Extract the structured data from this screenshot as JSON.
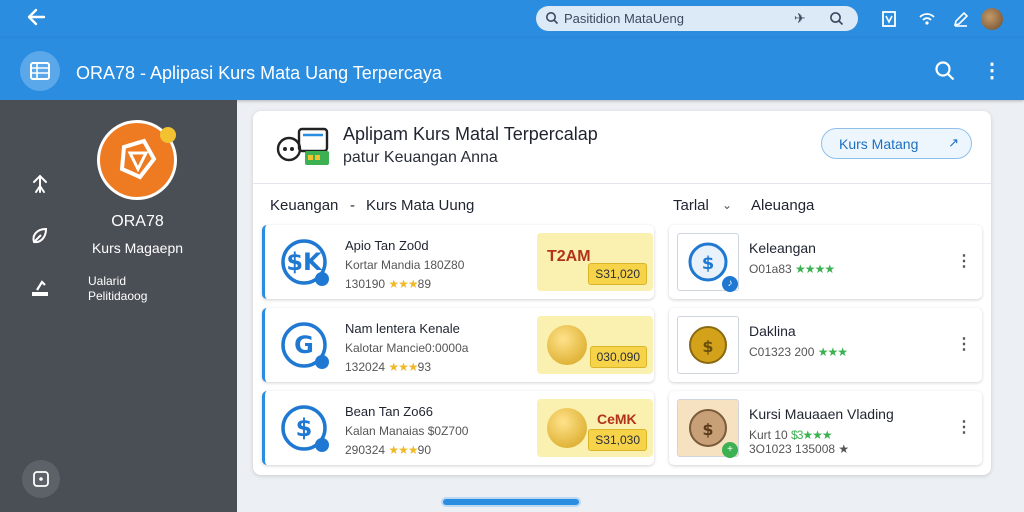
{
  "statusbar": {
    "search_text": "Pasitidion MataUeng"
  },
  "app": {
    "title": "ORA78 - Aplipasi Kurs Mata Uang Terpercaya"
  },
  "sidebar": {
    "brand_name": "ORA78",
    "brand_sub": "Kurs Magaepn",
    "item_text_line1": "Ualarid",
    "item_text_line2": "Pelitidaoog",
    "icons": [
      "person-up-icon",
      "leaf-icon",
      "upload-icon",
      "square-dot-icon"
    ]
  },
  "hero": {
    "title": "Aplipam Kurs Matal Terpercalap",
    "subtitle": "patur Keuangan Anna",
    "button_label": "Kurs Matang",
    "button_arrow": "↗"
  },
  "breadcrumb": {
    "left": "Keuangan",
    "sep": "-",
    "middle": "Kurs Mata Uung",
    "right_label": "Tarlal",
    "right_second": "Aleuanga"
  },
  "left_items": [
    {
      "title": "Apio Tan Zo0d",
      "line2": "Kortar Mandia 180Z80",
      "line3_num": "130190",
      "line3_stars": "★★★",
      "line3_tail": "89",
      "price": "S31,020",
      "tag": "T2AM"
    },
    {
      "title": "Nam lentera Kenale",
      "line2": "Kalotar Mancie0:0000a",
      "line3_num": "132024",
      "line3_stars": "★★★",
      "line3_tail": "93",
      "price": "030,090",
      "tag": ""
    },
    {
      "title": "Bean Tan Zo66",
      "line2": "Kalan Manaias $0Z700",
      "line3_num": "290324",
      "line3_stars": "★★★",
      "line3_tail": "90",
      "price": "S31,030",
      "tag": "CeMK"
    }
  ],
  "right_items": [
    {
      "title": "Keleangan",
      "line2_num": "O01a83",
      "line2_stars": "★★★★",
      "line3": ""
    },
    {
      "title": "Daklina",
      "line2_num": "C01323 200",
      "line2_stars": "★★★",
      "line3": ""
    },
    {
      "title": "Kursi Mauaaen Vlading",
      "line2_num": "Kurt 10",
      "line2_stars": "$3★★★",
      "line3": "3O1023 135008 ★"
    }
  ],
  "colors": {
    "primary": "#2b8de0",
    "sidebar": "#4a4e55",
    "accent_orange": "#ee7a22",
    "gold": "#f0b92a",
    "green": "#3bb152"
  }
}
